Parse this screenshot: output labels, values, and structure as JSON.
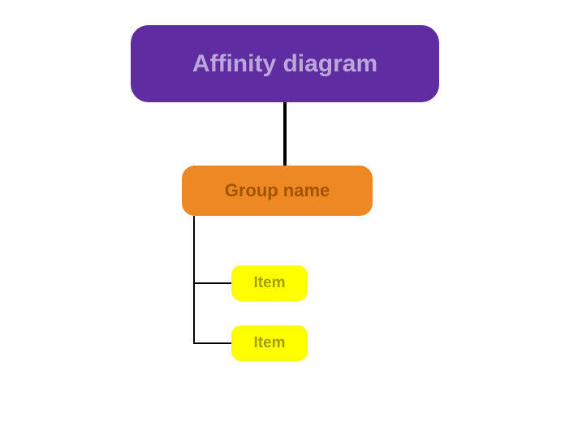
{
  "root": {
    "label": "Affinity diagram"
  },
  "group": {
    "label": "Group name"
  },
  "items": [
    {
      "label": "Item"
    },
    {
      "label": "Item"
    }
  ]
}
